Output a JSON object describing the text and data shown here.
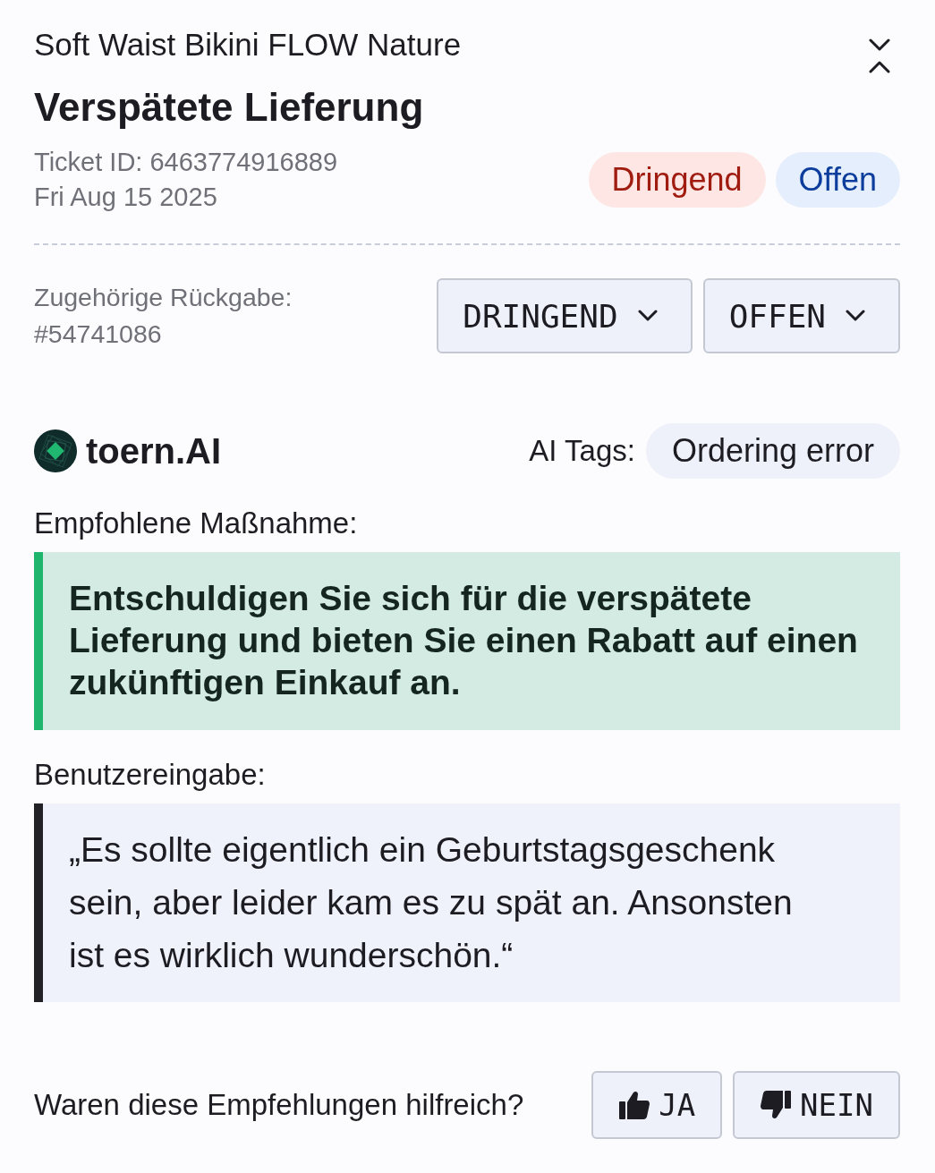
{
  "header": {
    "product": "Soft Waist Bikini FLOW Nature",
    "title": "Verspätete Lieferung",
    "ticket_id": "Ticket ID: 6463774916889",
    "date": "Fri Aug 15 2025"
  },
  "badges": [
    {
      "label": "Dringend",
      "kind": "priority"
    },
    {
      "label": "Offen",
      "kind": "status"
    }
  ],
  "related_return": {
    "label": "Zugehörige Rückgabe:",
    "value": "#54741086"
  },
  "dropdowns": [
    {
      "value": "DRINGEND"
    },
    {
      "value": "OFFEN"
    }
  ],
  "ai": {
    "brand": "toern.AI",
    "tags_label": "AI Tags:",
    "tags": [
      "Ordering error"
    ]
  },
  "recommendation": {
    "label": "Empfohlene Maßnahme:",
    "text": "Entschuldigen Sie sich für die verspätete Lieferung und bieten Sie einen Rabatt auf einen zukünftigen Einkauf an."
  },
  "user_input": {
    "label": "Benutzereingabe:",
    "text": "„Es sollte eigentlich ein Geburtstagsgeschenk sein, aber leider kam es zu spät an. Ansonsten ist es wirklich wunderschön.“"
  },
  "feedback": {
    "question": "Waren diese Empfehlungen hilfreich?",
    "buttons": [
      {
        "label": "JA",
        "kind": "up"
      },
      {
        "label": "NEIN",
        "kind": "down"
      }
    ]
  }
}
